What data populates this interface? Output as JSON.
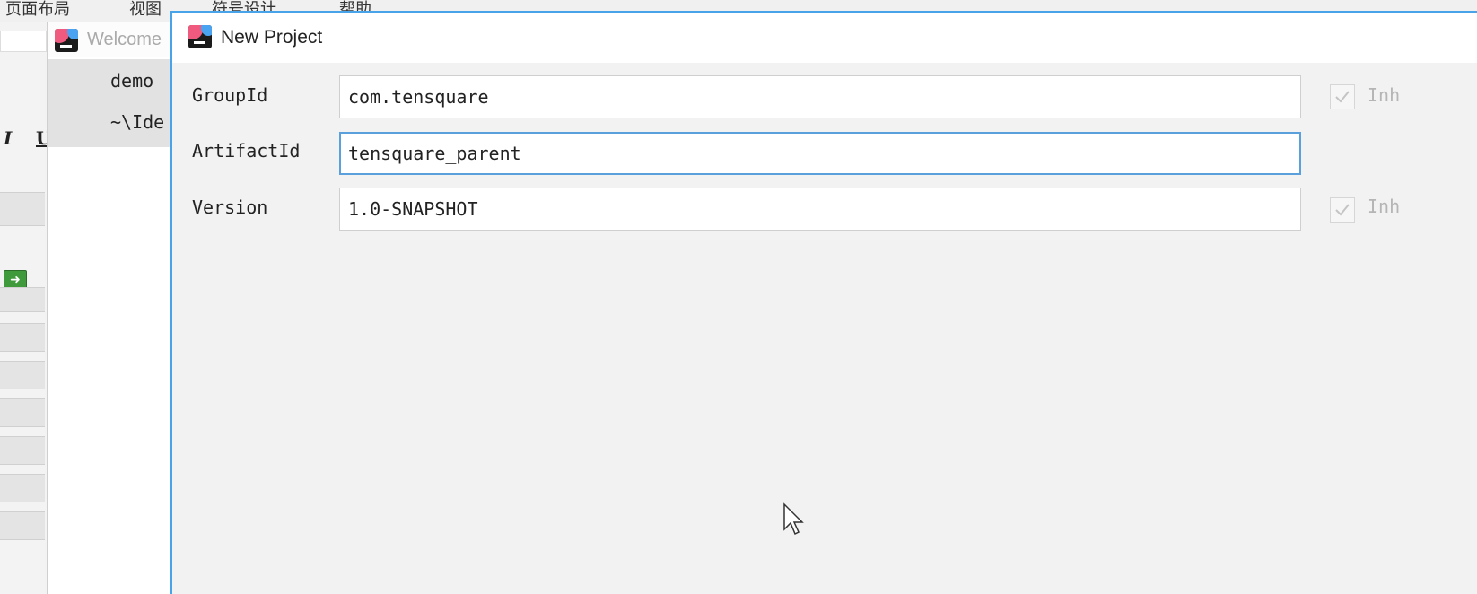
{
  "background_app": {
    "menu": [
      "页面布局",
      "视图",
      "符号设计",
      "帮助"
    ],
    "italic_label": "I",
    "underline_label": "U"
  },
  "welcome_window": {
    "title": "Welcome",
    "recent_project": {
      "name": "demo",
      "path": "~\\Ide"
    }
  },
  "dialog": {
    "title": "New Project",
    "fields": {
      "group_id": {
        "label": "GroupId",
        "value": "com.tensquare",
        "inherit_label": "Inh",
        "inherit_checked": true
      },
      "artifact_id": {
        "label": "ArtifactId",
        "value": "tensquare_parent"
      },
      "version": {
        "label": "Version",
        "value": "1.0-SNAPSHOT",
        "inherit_label": "Inh",
        "inherit_checked": true
      }
    }
  },
  "colors": {
    "accent": "#49a3e8",
    "dialog_bg": "#f2f2f2",
    "focus_border": "#5aa0dd"
  }
}
